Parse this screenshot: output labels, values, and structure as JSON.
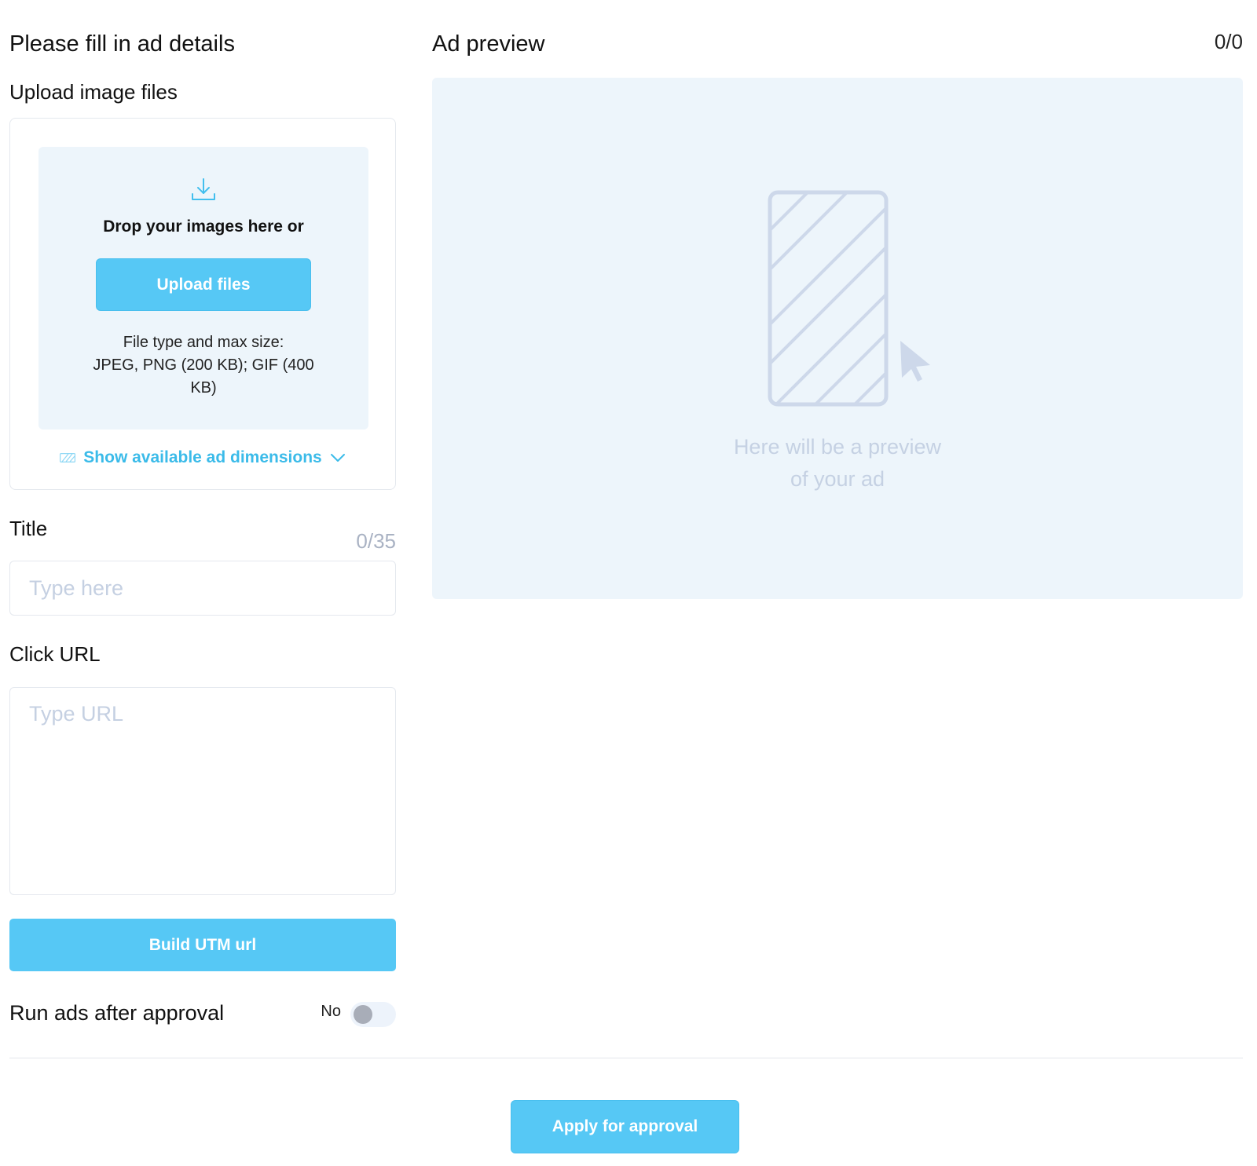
{
  "form": {
    "heading": "Please fill in ad details",
    "upload": {
      "label": "Upload image files",
      "icon": "download-icon",
      "drop_text": "Drop your images here or",
      "button_label": "Upload files",
      "file_info_line1": "File type and max size:",
      "file_info_line2": "JPEG, PNG (200 KB); GIF (400 KB)",
      "dimensions_link": "Show available ad dimensions"
    },
    "title": {
      "label": "Title",
      "counter": "0/35",
      "placeholder": "Type here",
      "value": ""
    },
    "click_url": {
      "label": "Click URL",
      "placeholder": "Type URL",
      "value": ""
    },
    "utm_button": "Build UTM url",
    "run_after_approval": {
      "label": "Run ads after approval",
      "state_label": "No",
      "enabled": false
    }
  },
  "preview": {
    "heading": "Ad preview",
    "counter": "0/0",
    "placeholder_line1": "Here will be a preview",
    "placeholder_line2": "of your ad"
  },
  "footer": {
    "apply_button": "Apply for approval"
  },
  "colors": {
    "accent": "#56c8f5",
    "link": "#3bbbe9",
    "panel_bg": "#edf5fb",
    "placeholder": "#c5d1e3"
  }
}
